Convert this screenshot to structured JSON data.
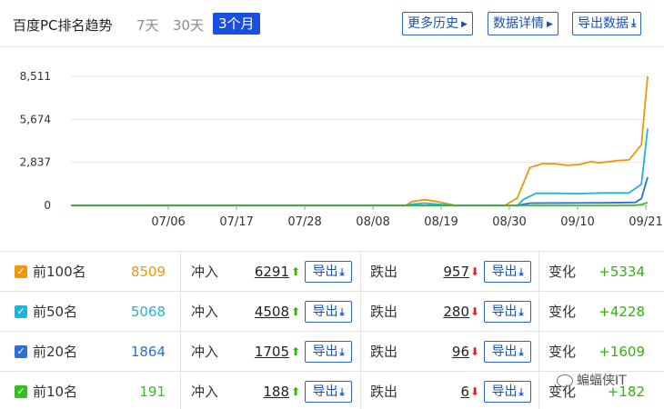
{
  "header": {
    "title": "百度PC排名趋势",
    "ranges": [
      "7天",
      "30天",
      "3个月"
    ],
    "active_range": "3个月",
    "buttons": [
      "更多历史",
      "数据详情",
      "导出数据"
    ]
  },
  "chart_data": {
    "type": "line",
    "x_ticks": [
      "07/06",
      "07/17",
      "07/28",
      "08/08",
      "08/19",
      "08/30",
      "09/10",
      "09/21"
    ],
    "y_ticks": [
      "0",
      "2,837",
      "5,674",
      "8,511"
    ],
    "ylim": [
      0,
      8511
    ],
    "grid": "horizontal",
    "colors": {
      "top100": "#f0960a",
      "top50": "#1fb5d6",
      "top20": "#2b6fd9",
      "top10": "#33c020"
    },
    "series": [
      {
        "key": "top100",
        "points": [
          [
            0,
            0
          ],
          [
            54,
            0
          ],
          [
            55,
            250
          ],
          [
            57,
            380
          ],
          [
            59,
            250
          ],
          [
            62,
            0
          ],
          [
            64,
            0
          ],
          [
            66,
            0
          ],
          [
            68,
            0
          ],
          [
            70,
            0
          ],
          [
            72,
            500
          ],
          [
            74,
            2500
          ],
          [
            76,
            2750
          ],
          [
            78,
            2750
          ],
          [
            80,
            2650
          ],
          [
            82,
            2700
          ],
          [
            84,
            2900
          ],
          [
            85,
            2800
          ],
          [
            88,
            2950
          ],
          [
            90,
            3000
          ],
          [
            92,
            4000
          ],
          [
            93,
            8509
          ]
        ]
      },
      {
        "key": "top50",
        "points": [
          [
            0,
            0
          ],
          [
            54,
            0
          ],
          [
            55,
            80
          ],
          [
            57,
            150
          ],
          [
            59,
            80
          ],
          [
            62,
            0
          ],
          [
            72,
            0
          ],
          [
            73,
            400
          ],
          [
            75,
            800
          ],
          [
            78,
            800
          ],
          [
            82,
            780
          ],
          [
            86,
            820
          ],
          [
            90,
            820
          ],
          [
            92,
            1400
          ],
          [
            93,
            5068
          ]
        ]
      },
      {
        "key": "top20",
        "points": [
          [
            0,
            0
          ],
          [
            72,
            0
          ],
          [
            74,
            150
          ],
          [
            80,
            160
          ],
          [
            86,
            170
          ],
          [
            91,
            200
          ],
          [
            92,
            450
          ],
          [
            93,
            1864
          ]
        ]
      },
      {
        "key": "top10",
        "points": [
          [
            0,
            0
          ],
          [
            88,
            0
          ],
          [
            91,
            10
          ],
          [
            92,
            60
          ],
          [
            93,
            191
          ]
        ]
      }
    ],
    "x_start": "06/20",
    "x_end": "09/21"
  },
  "rows": [
    {
      "label": "前100名",
      "total": "8509",
      "in_label": "冲入",
      "in": "6291",
      "export": "导出",
      "out_label": "跌出",
      "out": "957",
      "chg_label": "变化",
      "chg": "+5334"
    },
    {
      "label": "前50名",
      "total": "5068",
      "in_label": "冲入",
      "in": "4508",
      "export": "导出",
      "out_label": "跌出",
      "out": "280",
      "chg_label": "变化",
      "chg": "+4228"
    },
    {
      "label": "前20名",
      "total": "1864",
      "in_label": "冲入",
      "in": "1705",
      "export": "导出",
      "out_label": "跌出",
      "out": "96",
      "chg_label": "变化",
      "chg": "+1609"
    },
    {
      "label": "前10名",
      "total": "191",
      "in_label": "冲入",
      "in": "188",
      "export": "导出",
      "out_label": "跌出",
      "out": "6",
      "chg_label": "变化",
      "chg": "+182"
    }
  ],
  "watermark": "蝙蝠侠IT"
}
